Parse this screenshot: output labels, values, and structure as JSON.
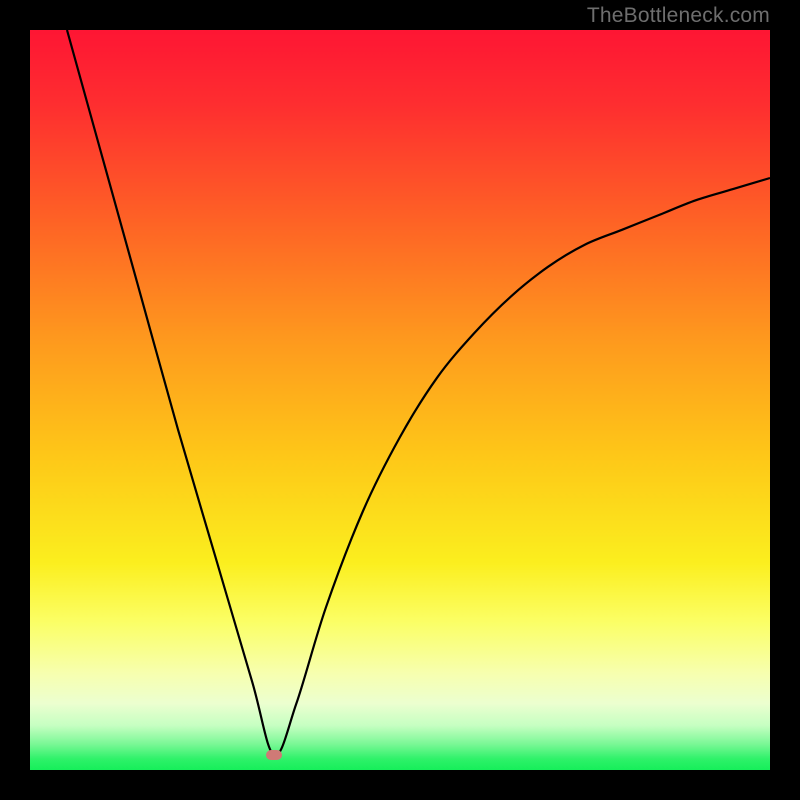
{
  "watermark": "TheBottleneck.com",
  "colors": {
    "gradient_top": "#fe1735",
    "gradient_mid": "#feda17",
    "gradient_low": "#faff9f",
    "gradient_bottom": "#17ef5b",
    "curve": "#000000",
    "marker": "#cf7a76",
    "frame": "#000000",
    "watermark_text": "#6e6e6e"
  },
  "chart_data": {
    "type": "line",
    "title": "",
    "xlabel": "",
    "ylabel": "",
    "xlim": [
      0,
      100
    ],
    "ylim": [
      0,
      100
    ],
    "grid": false,
    "legend": false,
    "marker": {
      "x": 33,
      "y": 2
    },
    "series": [
      {
        "name": "bottleneck-curve",
        "x": [
          5,
          10,
          15,
          20,
          25,
          30,
          33,
          36,
          40,
          45,
          50,
          55,
          60,
          65,
          70,
          75,
          80,
          85,
          90,
          95,
          100
        ],
        "y": [
          100,
          82,
          64,
          46,
          29,
          12,
          2,
          9,
          22,
          35,
          45,
          53,
          59,
          64,
          68,
          71,
          73,
          75,
          77,
          78.5,
          80
        ]
      }
    ]
  }
}
